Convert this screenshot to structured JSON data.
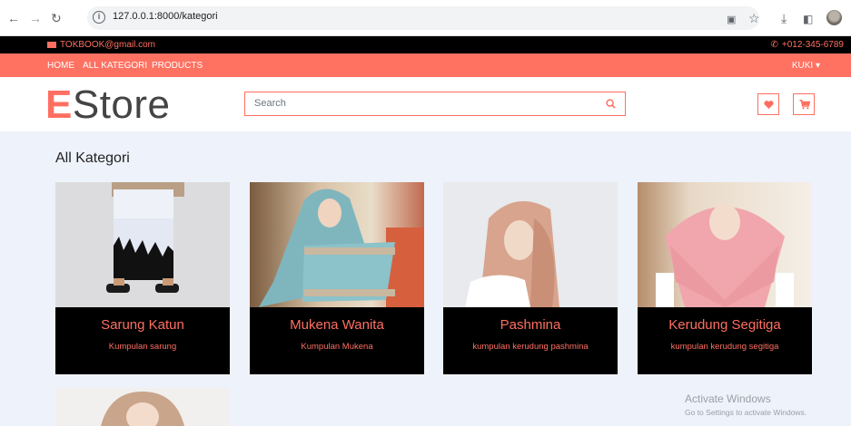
{
  "browser": {
    "url": "127.0.0.1:8000/kategori"
  },
  "topbar": {
    "email": "TOKBOOK@gmail.com",
    "phone": "+012-345-6789"
  },
  "nav": {
    "home": "HOME",
    "all_kategori": "ALL KATEGORI",
    "products": "PRODUCTS",
    "user": "KUKI ▾"
  },
  "logo": {
    "first_letter": "E",
    "rest": "Store"
  },
  "search": {
    "placeholder": "Search"
  },
  "section": {
    "title": "All Kategori"
  },
  "categories": [
    {
      "name": "Sarung Katun",
      "desc": "Kumpulan sarung"
    },
    {
      "name": "Mukena Wanita",
      "desc": "Kumpulan Mukena"
    },
    {
      "name": "Pashmina",
      "desc": "kumpulan kerudung pashmina"
    },
    {
      "name": "Kerudung Segitiga",
      "desc": "kumpulan kerudung segitiga"
    }
  ],
  "watermark": {
    "line1": "Activate Windows",
    "line2": "Go to Settings to activate Windows."
  },
  "colors": {
    "accent": "#ff6f61",
    "topbar": "#000000",
    "page_bg": "#eef2fb"
  }
}
